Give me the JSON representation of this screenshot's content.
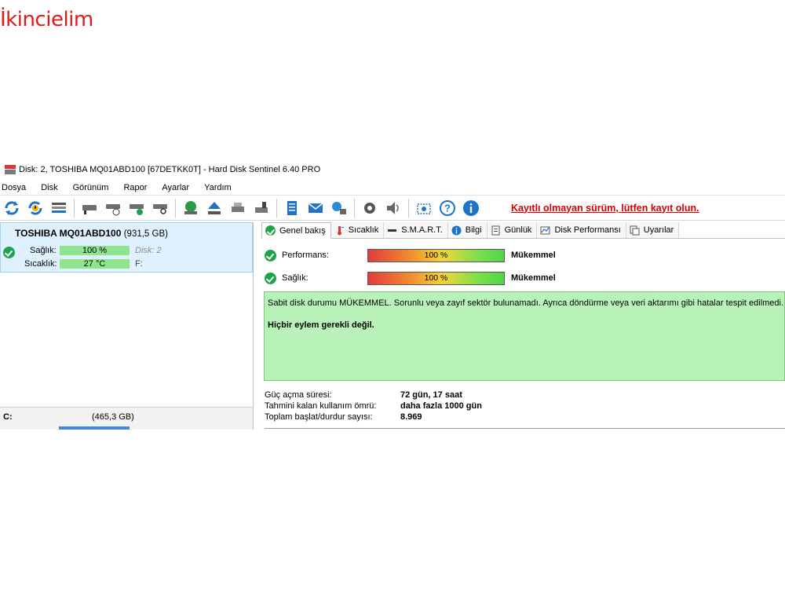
{
  "window": {
    "title": "Disk: 2, TOSHIBA MQ01ABD100 [67DETKK0T]  -  Hard Disk Sentinel 6.40 PRO"
  },
  "watermark": "İkincielim",
  "menu": [
    "Dosya",
    "Disk",
    "Görünüm",
    "Rapor",
    "Ayarlar",
    "Yardım"
  ],
  "toolbar": {
    "icons": [
      "refresh-icon",
      "refresh-warning-icon",
      "disk-list-icon",
      "disk-icon",
      "disk-timer-icon",
      "disk-check-icon",
      "disk-search-icon",
      "globe-disk-icon",
      "eject-icon",
      "disk-tools-icon",
      "disk-write-icon",
      "report-icon",
      "mail-icon",
      "network-icon",
      "settings-icon",
      "sound-icon",
      "screenshot-icon",
      "help-icon",
      "info-icon"
    ],
    "registration_warning": "Kayıtlı olmayan sürüm, lütfen kayıt olun."
  },
  "disk_list": {
    "name": "TOSHIBA MQ01ABD100",
    "size": "(931,5 GB)",
    "health_label": "Sağlık:",
    "health_value": "100 %",
    "disk_index": "Disk: 2",
    "temp_label": "Sıcaklık:",
    "temp_value": "27 °C",
    "drive_letter": "F:",
    "partition_letter": "C:",
    "partition_size": "(465,3 GB)"
  },
  "tabs": [
    {
      "label": "Genel bakış",
      "icon": "check-icon",
      "active": true
    },
    {
      "label": "Sıcaklık",
      "icon": "thermometer-icon",
      "active": false
    },
    {
      "label": "S.M.A.R.T.",
      "icon": "smart-icon",
      "active": false
    },
    {
      "label": "Bilgi",
      "icon": "info-icon",
      "active": false
    },
    {
      "label": "Günlük",
      "icon": "log-icon",
      "active": false
    },
    {
      "label": "Disk Performansı",
      "icon": "chart-icon",
      "active": false
    },
    {
      "label": "Uyarılar",
      "icon": "alerts-icon",
      "active": false
    }
  ],
  "overview": {
    "performance_label": "Performans:",
    "performance_value": "100 %",
    "performance_rating": "Mükemmel",
    "health_label": "Sağlık:",
    "health_value": "100 %",
    "health_rating": "Mükemmel",
    "status_text": "Sabit disk durumu MÜKEMMEL. Sorunlu veya zayıf sektör bulunamadı. Ayrıca döndürme veya veri aktarımı gibi hatalar tespit edilmedi.",
    "action_text": "Hiçbir eylem gerekli değil.",
    "power_on_label": "Güç açma süresi:",
    "power_on_value": "72 gün, 17 saat",
    "remaining_label": "Tahmini kalan kullanım ömrü:",
    "remaining_value": "daha fazla 1000 gün",
    "start_stop_label": "Toplam başlat/durdur sayısı:",
    "start_stop_value": "8.969"
  },
  "colors": {
    "status_bg": "#b9f2b9",
    "selected_disk_bg": "#dff1ff",
    "warning_text": "#d40000",
    "watermark": "#e01b1b"
  }
}
